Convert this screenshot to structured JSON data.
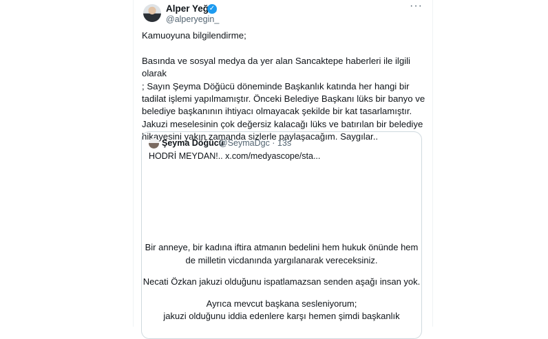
{
  "author": {
    "name": "Alper Yeğin",
    "handle": "@alperyegin_",
    "verified_mark": "✓",
    "more_label": "···"
  },
  "tweet": {
    "text": "Kamuoyuna bilgilendirme;\n\nBasında ve sosyal medya da yer alan Sancaktepe haberleri ile ilgili olarak\n; Sayın Şeyma Döğücü döneminde  Başkanlık katında her hangi bir\ntadilat işlemi yapılmamıştır. Önceki Belediye Başkanı lüks bir banyo ve\nbelediye başkanının ihtiyacı olmayacak şekilde bir kat tasarlamıştır.\nJakuzi meselesinin çok değersiz kalacağı  lüks ve batırılan bir belediye\nhikayesini yakın zamanda sizlerle paylaşacağım. Saygılar.."
  },
  "quote": {
    "name": "Şeyma Döğücü",
    "handle": "@SeymaDgc · 13s",
    "text": "HODRİ MEYDAN!..  x.com/medyascope/sta...",
    "image_lines": {
      "line1": "Bir anneye, bir kadına iftira atmanın bedelini hem hukuk önünde hem",
      "line2": "de milletin vicdanında yargılanarak vereceksiniz.",
      "line3": "Necati Özkan jakuzi olduğunu ispatlamazsan senden aşağı insan yok.",
      "line4": "Ayrıca mevcut başkana sesleniyorum;",
      "line5": "jakuzi olduğunu iddia edenlere karşı hemen şimdi başkanlık"
    }
  },
  "colors": {
    "accent": "#1d9bf0",
    "text": "#0f1419",
    "muted": "#536471",
    "border": "#cfd9de"
  }
}
